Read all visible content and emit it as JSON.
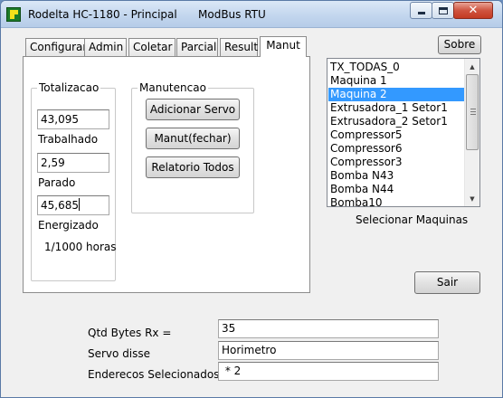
{
  "window": {
    "title": "Rodelta HC-1180 - Principal",
    "subtitle": "ModBus RTU"
  },
  "tabs": [
    {
      "label": "Configurar"
    },
    {
      "label": "Admin"
    },
    {
      "label": "Coletar"
    },
    {
      "label": "Parcial"
    },
    {
      "label": "Result"
    },
    {
      "label": "Manut"
    }
  ],
  "active_tab": "Manut",
  "totalizacao": {
    "legend": "Totalizacao",
    "trabalhado_value": "43,095",
    "trabalhado_label": "Trabalhado",
    "parado_value": "2,59",
    "parado_label": "Parado",
    "energizado_value": "45,685",
    "energizado_label": "Energizado",
    "unit_note": "1/1000 horas"
  },
  "manutencao": {
    "legend": "Manutencao",
    "buttons": [
      "Adicionar Servo",
      "Manut(fechar)",
      "Relatorio Todos"
    ]
  },
  "sobre_label": "Sobre",
  "machines": {
    "items": [
      "TX_TODAS_0",
      "Maquina 1",
      "Maquina 2",
      "Extrusadora_1 Setor1",
      "Extrusadora_2 Setor1",
      "Compressor5",
      "Compressor6",
      "Compressor3",
      "Bomba N43",
      "Bomba N44",
      "Bomba10"
    ],
    "selected": "Maquina 2",
    "caption": "Selecionar Maquinas"
  },
  "sair_label": "Sair",
  "status": {
    "qtd_bytes_label": "Qtd Bytes Rx =",
    "qtd_bytes_value": "35",
    "servo_disse_label": "Servo disse",
    "servo_disse_value": "Horimetro",
    "enderecos_label": "Enderecos Selecionados",
    "enderecos_value": " * 2"
  },
  "colors": {
    "selection": "#3399ff",
    "close_button": "#c43a22"
  }
}
